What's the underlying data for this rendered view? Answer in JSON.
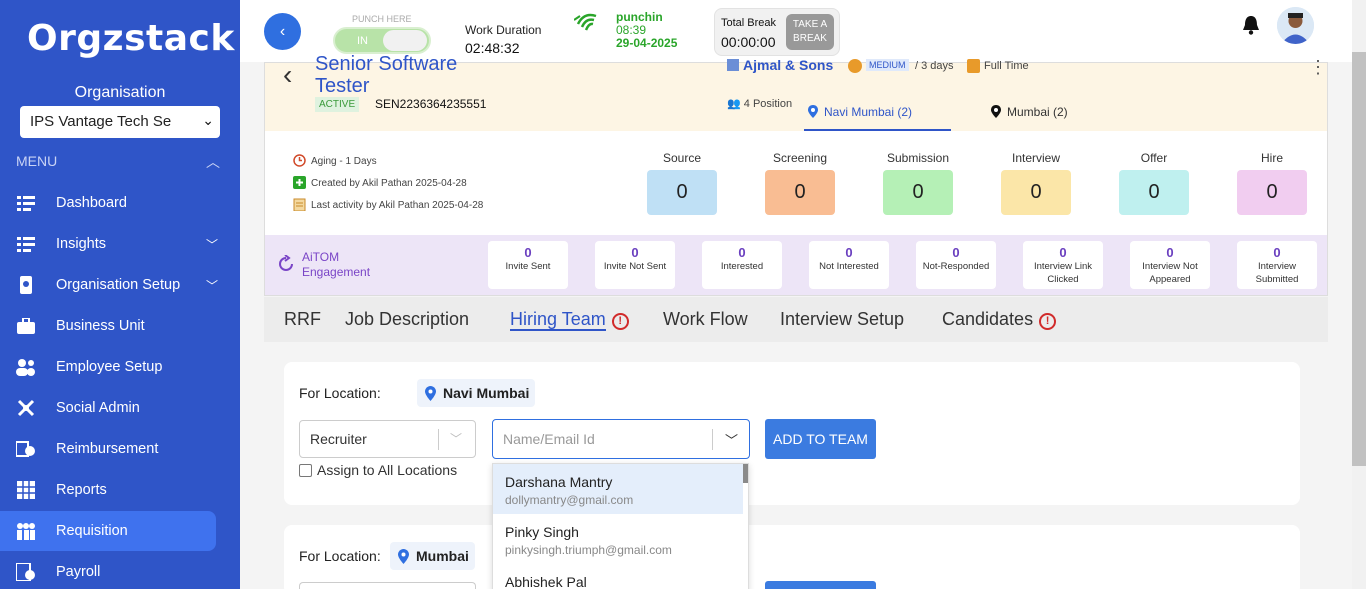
{
  "brand": {
    "logo_text": "Orgzstack"
  },
  "sidebar": {
    "org_title": "Organisation",
    "org_selected": "IPS Vantage Tech Se",
    "menu_label": "MENU",
    "items": [
      {
        "label": "Dashboard",
        "icon": "dashboard-icon"
      },
      {
        "label": "Insights",
        "icon": "insights-icon"
      },
      {
        "label": "Organisation Setup",
        "icon": "organisation-icon"
      },
      {
        "label": "Business Unit",
        "icon": "briefcase-icon"
      },
      {
        "label": "Employee Setup",
        "icon": "employee-icon"
      },
      {
        "label": "Social Admin",
        "icon": "social-icon"
      },
      {
        "label": "Reimbursement",
        "icon": "reimbursement-icon"
      },
      {
        "label": "Reports",
        "icon": "reports-icon"
      },
      {
        "label": "Requisition",
        "icon": "requisition-icon"
      },
      {
        "label": "Payroll",
        "icon": "payroll-icon"
      }
    ]
  },
  "topbar": {
    "punch_here": "PUNCH HERE",
    "punch_toggle": "IN",
    "work_duration_label": "Work Duration",
    "work_duration_value": "02:48:32",
    "punchin_label": "punchin",
    "punchin_time": "08:39",
    "punchin_date": "29-04-2025",
    "total_break_label": "Total Break",
    "total_break_value": "00:00:00",
    "take_break_button": "TAKE A BREAK"
  },
  "job": {
    "title": "Senior Software Tester",
    "status": "ACTIVE",
    "code": "SEN2236364235551",
    "company": "Ajmal & Sons",
    "priority": "MEDIUM",
    "duration": "/ 3 days",
    "employment_type": "Full Time",
    "positions": "4 Position",
    "location_tabs": [
      "Navi Mumbai (2)",
      "Mumbai (2)"
    ],
    "aging": "Aging - 1 Days",
    "created_by": "Created by Akil Pathan 2025-04-28",
    "last_activity": "Last activity by Akil Pathan 2025-04-28"
  },
  "pipeline": [
    {
      "label": "Source",
      "value": "0",
      "color": "#bfe0f5"
    },
    {
      "label": "Screening",
      "value": "0",
      "color": "#f9bd93"
    },
    {
      "label": "Submission",
      "value": "0",
      "color": "#b5f0b6"
    },
    {
      "label": "Interview",
      "value": "0",
      "color": "#fbe6a8"
    },
    {
      "label": "Offer",
      "value": "0",
      "color": "#bff0ef"
    },
    {
      "label": "Hire",
      "value": "0",
      "color": "#f1cdf0"
    }
  ],
  "aitom": {
    "label_line1": "AiTOM",
    "label_line2": "Engagement",
    "metrics": [
      {
        "value": "0",
        "label": "Invite Sent"
      },
      {
        "value": "0",
        "label": "Invite Not Sent"
      },
      {
        "value": "0",
        "label": "Interested"
      },
      {
        "value": "0",
        "label": "Not Interested"
      },
      {
        "value": "0",
        "label": "Not-Responded"
      },
      {
        "value": "0",
        "label": "Interview Link Clicked"
      },
      {
        "value": "0",
        "label": "Interview Not Appeared"
      },
      {
        "value": "0",
        "label": "Interview Submitted"
      }
    ]
  },
  "tabs": [
    "RRF",
    "Job Description",
    "Hiring Team",
    "Work Flow",
    "Interview Setup",
    "Candidates"
  ],
  "hiring_team": {
    "for_location_label": "For Location:",
    "locations": [
      "Navi Mumbai",
      "Mumbai"
    ],
    "role_value": "Recruiter",
    "name_placeholder": "Name/Email Id",
    "add_button": "ADD TO TEAM",
    "assign_all": "Assign to All Locations",
    "dropdown": [
      {
        "name": "Darshana Mantry",
        "email": "dollymantry@gmail.com"
      },
      {
        "name": "Pinky Singh",
        "email": "pinkysingh.triumph@gmail.com"
      },
      {
        "name": "Abhishek Pal",
        "email": ""
      }
    ]
  }
}
